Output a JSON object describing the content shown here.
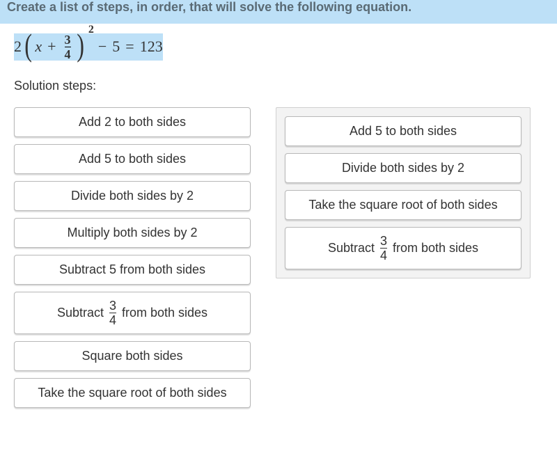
{
  "prompt": "Create a list of steps, in order, that will solve the following equation.",
  "equation": {
    "lead_coef": "2",
    "lparen": "(",
    "var": "x",
    "plus": "+",
    "frac_num": "3",
    "frac_den": "4",
    "rparen": ")",
    "exponent": "2",
    "minus": "−",
    "sub_const": "5",
    "equals": "=",
    "rhs": "123"
  },
  "section_label": "Solution steps:",
  "source_tiles": [
    {
      "kind": "plain",
      "label": "Add 2 to both sides"
    },
    {
      "kind": "plain",
      "label": "Add 5 to both sides"
    },
    {
      "kind": "plain",
      "label": "Divide both sides by 2"
    },
    {
      "kind": "plain",
      "label": "Multiply both sides by 2"
    },
    {
      "kind": "plain",
      "label": "Subtract 5 from both sides"
    },
    {
      "kind": "frac",
      "pre": "Subtract",
      "num": "3",
      "den": "4",
      "post": "from both sides"
    },
    {
      "kind": "plain",
      "label": "Square both sides"
    },
    {
      "kind": "plain",
      "label": "Take the square root of both sides"
    }
  ],
  "answer_tiles": [
    {
      "kind": "plain",
      "label": "Add 5 to both sides"
    },
    {
      "kind": "plain",
      "label": "Divide both sides by 2"
    },
    {
      "kind": "plain",
      "label": "Take the square root of both sides"
    },
    {
      "kind": "frac",
      "pre": "Subtract",
      "num": "3",
      "den": "4",
      "post": "from both sides"
    }
  ]
}
